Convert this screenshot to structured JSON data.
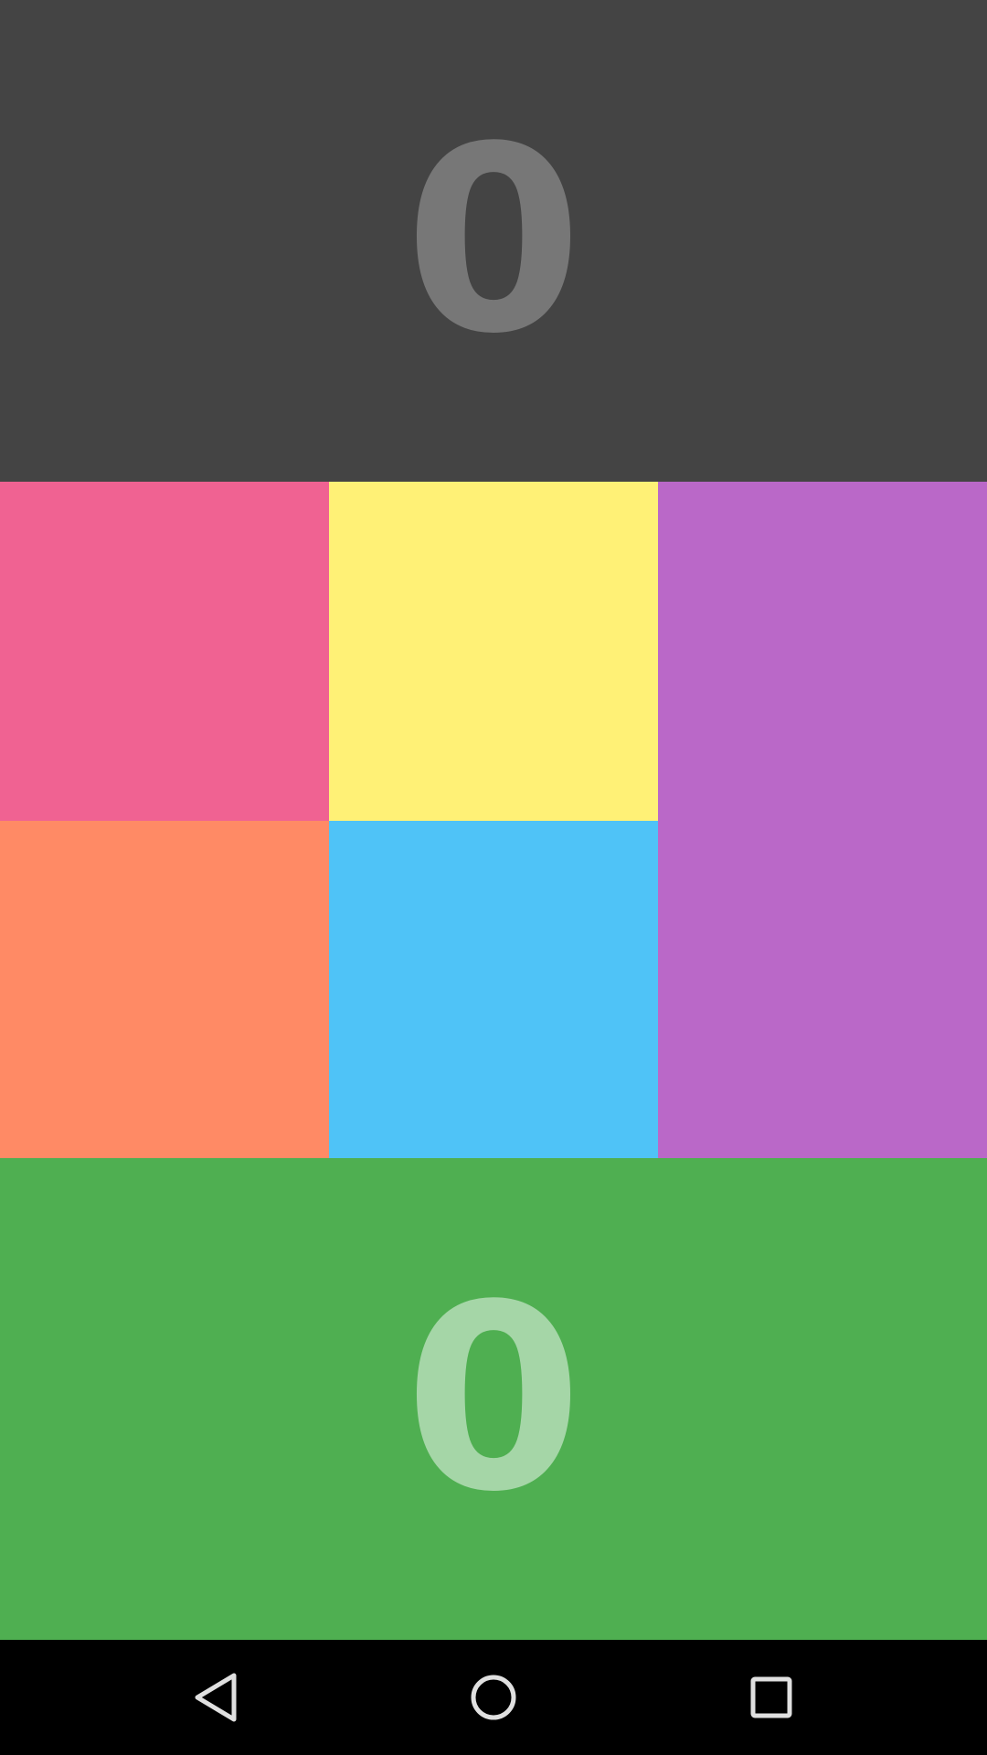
{
  "scores": {
    "top": "0",
    "bottom": "0"
  },
  "colors": {
    "top_panel_bg": "#444444",
    "top_score_text": "#777777",
    "bottom_panel_bg": "#4FAF51",
    "bottom_score_text": "#A5D6A7",
    "tile_pink": "#F06292",
    "tile_yellow": "#FFF176",
    "tile_purple": "#BA68C8",
    "tile_orange": "#FF8A65",
    "tile_blue": "#4FC3F7",
    "navbar_bg": "#000000",
    "nav_icon": "#E0E0E0"
  },
  "navbar": {
    "icons": [
      "back-icon",
      "home-icon",
      "recents-icon"
    ]
  }
}
